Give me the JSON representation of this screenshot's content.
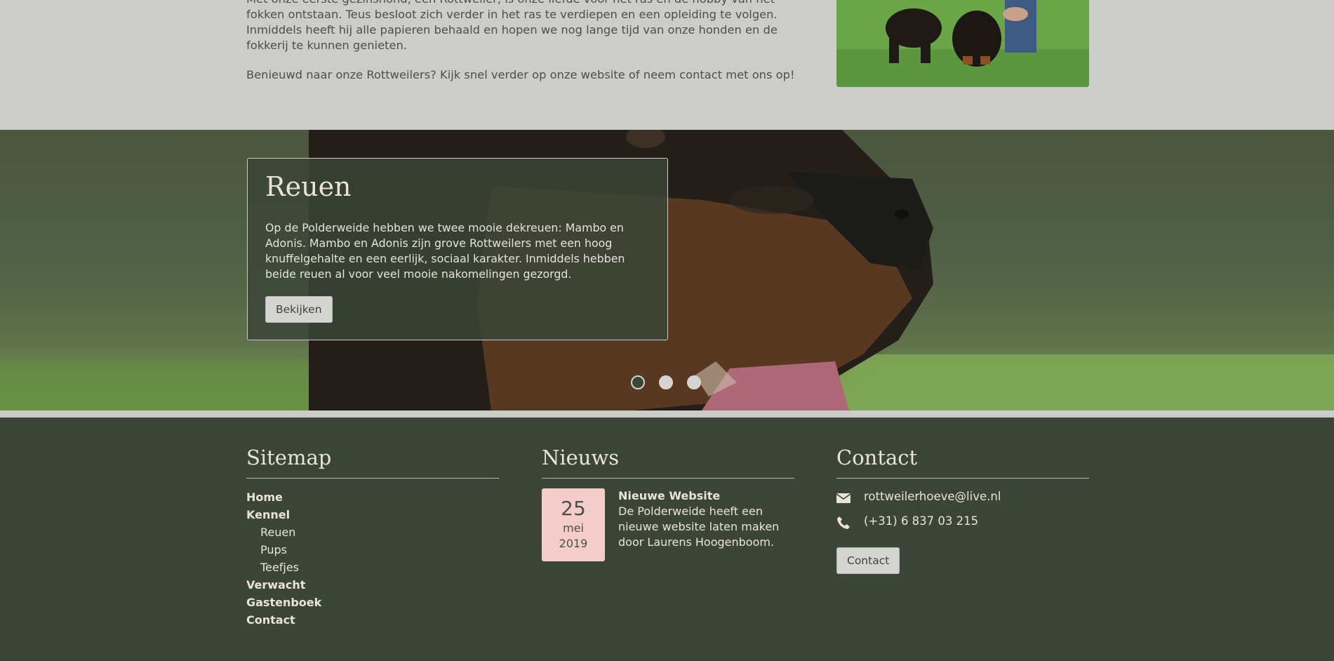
{
  "intro": {
    "paragraph_1": "Met onze eerste gezinshond, een Rottweiler, is onze liefde voor het ras en de hobby van het fokken ontstaan. Teus besloot zich verder in het ras te verdiepen en een opleiding te volgen. Inmiddels heeft hij alle papieren behaald en hopen we nog lange tijd van onze honden en de fokkerij te kunnen genieten.",
    "paragraph_2": "Benieuwd naar onze Rottweilers? Kijk snel verder op onze website of neem contact met ons op!"
  },
  "slider": {
    "title": "Reuen",
    "text": "Op de Polderweide hebben we twee mooie dekreuen: Mambo en Adonis. Mambo en Adonis zijn grove Rottweilers met een hoog knuffelgehalte en een eerlijk, sociaal karakter. Inmiddels hebben beide reuen al voor veel mooie nakomelingen gezorgd.",
    "button_label": "Bekijken",
    "slide_count": 3,
    "active_slide": 1
  },
  "footer": {
    "sitemap": {
      "heading": "Sitemap",
      "items": [
        {
          "label": "Home",
          "sub": false
        },
        {
          "label": "Kennel",
          "sub": false
        },
        {
          "label": "Reuen",
          "sub": true
        },
        {
          "label": "Pups",
          "sub": true
        },
        {
          "label": "Teefjes",
          "sub": true
        },
        {
          "label": "Verwacht",
          "sub": false
        },
        {
          "label": "Gastenboek",
          "sub": false
        },
        {
          "label": "Contact",
          "sub": false
        }
      ]
    },
    "news": {
      "heading": "Nieuws",
      "items": [
        {
          "day": "25",
          "month": "mei",
          "year": "2019",
          "title": "Nieuwe Website",
          "body": "De Polderweide heeft een nieuwe website laten maken door Laurens Hoogenboom."
        }
      ]
    },
    "contact": {
      "heading": "Contact",
      "email": "rottweilerhoeve@live.nl",
      "phone": "(+31) 6 837 03 215",
      "button_label": "Contact"
    }
  },
  "colors": {
    "footer_bg": "#3b4538",
    "page_bg": "#cccdc9",
    "accent_text": "#e9e4d6",
    "date_badge": "#f2cdc9"
  }
}
